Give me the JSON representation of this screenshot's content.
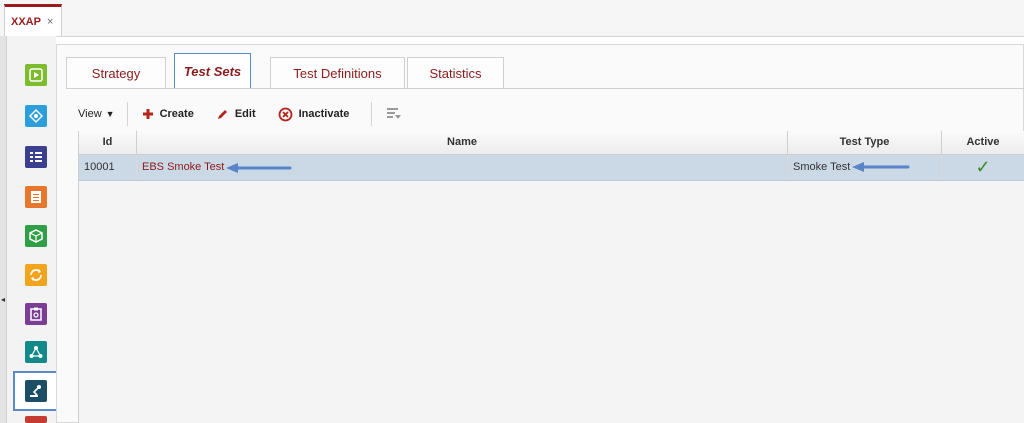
{
  "app_tab": {
    "label": "XXAP",
    "close": "×"
  },
  "rail": {
    "collapse": "◂",
    "icons": [
      {
        "name": "play-process-icon",
        "color": "#7dbb2f"
      },
      {
        "name": "network-diamond-icon",
        "color": "#2b9fd9"
      },
      {
        "name": "list-checks-icon",
        "color": "#3a3f8f"
      },
      {
        "name": "document-pages-icon",
        "color": "#e8772e"
      },
      {
        "name": "package-cube-icon",
        "color": "#2f9e44"
      },
      {
        "name": "refresh-cycle-icon",
        "color": "#f2a41c"
      },
      {
        "name": "clipboard-search-icon",
        "color": "#7a3e94"
      },
      {
        "name": "hierarchy-nodes-icon",
        "color": "#138a8a"
      },
      {
        "name": "robot-arm-icon",
        "color": "#1c4e66"
      }
    ]
  },
  "tabs": [
    {
      "label": "Strategy"
    },
    {
      "label": "Test Sets"
    },
    {
      "label": "Test Definitions"
    },
    {
      "label": "Statistics"
    }
  ],
  "toolbar": {
    "view": "View",
    "create": "Create",
    "edit": "Edit",
    "inactivate": "Inactivate"
  },
  "table": {
    "columns": [
      "Id",
      "Name",
      "Test Type",
      "Active"
    ],
    "rows": [
      {
        "id": "10001",
        "name": "EBS Smoke Test",
        "test_type": "Smoke Test",
        "active": "✓"
      }
    ]
  },
  "colors": {
    "brand": "#9a1b1b",
    "selected_row": "#cbd8e6",
    "arrow": "#5a84c8",
    "check": "#3c8a2e"
  }
}
